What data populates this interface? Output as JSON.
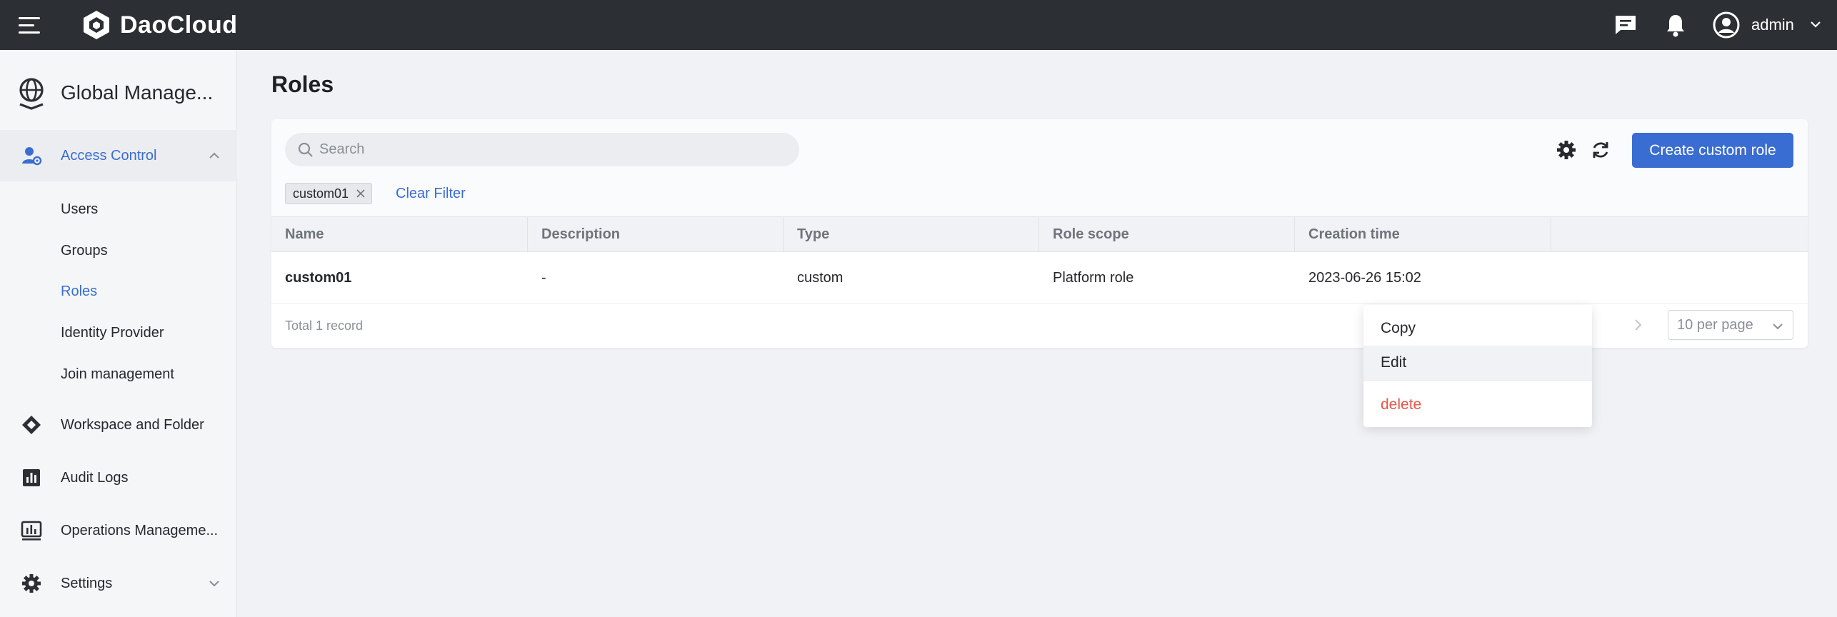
{
  "header": {
    "brand": "DaoCloud",
    "user": "admin"
  },
  "sidebar": {
    "app_title": "Global Manage...",
    "groups": [
      {
        "label": "Access Control"
      },
      {
        "label": "Workspace and Folder"
      },
      {
        "label": "Audit Logs"
      },
      {
        "label": "Operations Manageme..."
      },
      {
        "label": "Settings"
      }
    ],
    "sub_items": [
      {
        "label": "Users"
      },
      {
        "label": "Groups"
      },
      {
        "label": "Roles"
      },
      {
        "label": "Identity Provider"
      },
      {
        "label": "Join management"
      }
    ]
  },
  "main": {
    "title": "Roles",
    "search_placeholder": "Search",
    "create_button": "Create custom role",
    "filter_chip": "custom01",
    "clear_filter": "Clear Filter",
    "columns": [
      "Name",
      "Description",
      "Type",
      "Role scope",
      "Creation time"
    ],
    "rows": [
      {
        "name": "custom01",
        "description": "-",
        "type": "custom",
        "scope": "Platform role",
        "created": "2023-06-26 15:02"
      }
    ],
    "total": "Total 1 record",
    "per_page": "10 per page"
  },
  "menu": {
    "items": [
      "Copy",
      "Edit",
      "delete"
    ]
  },
  "colors": {
    "accent": "#3a6dd1",
    "topbar": "#2c2f33",
    "danger": "#e5564c"
  }
}
